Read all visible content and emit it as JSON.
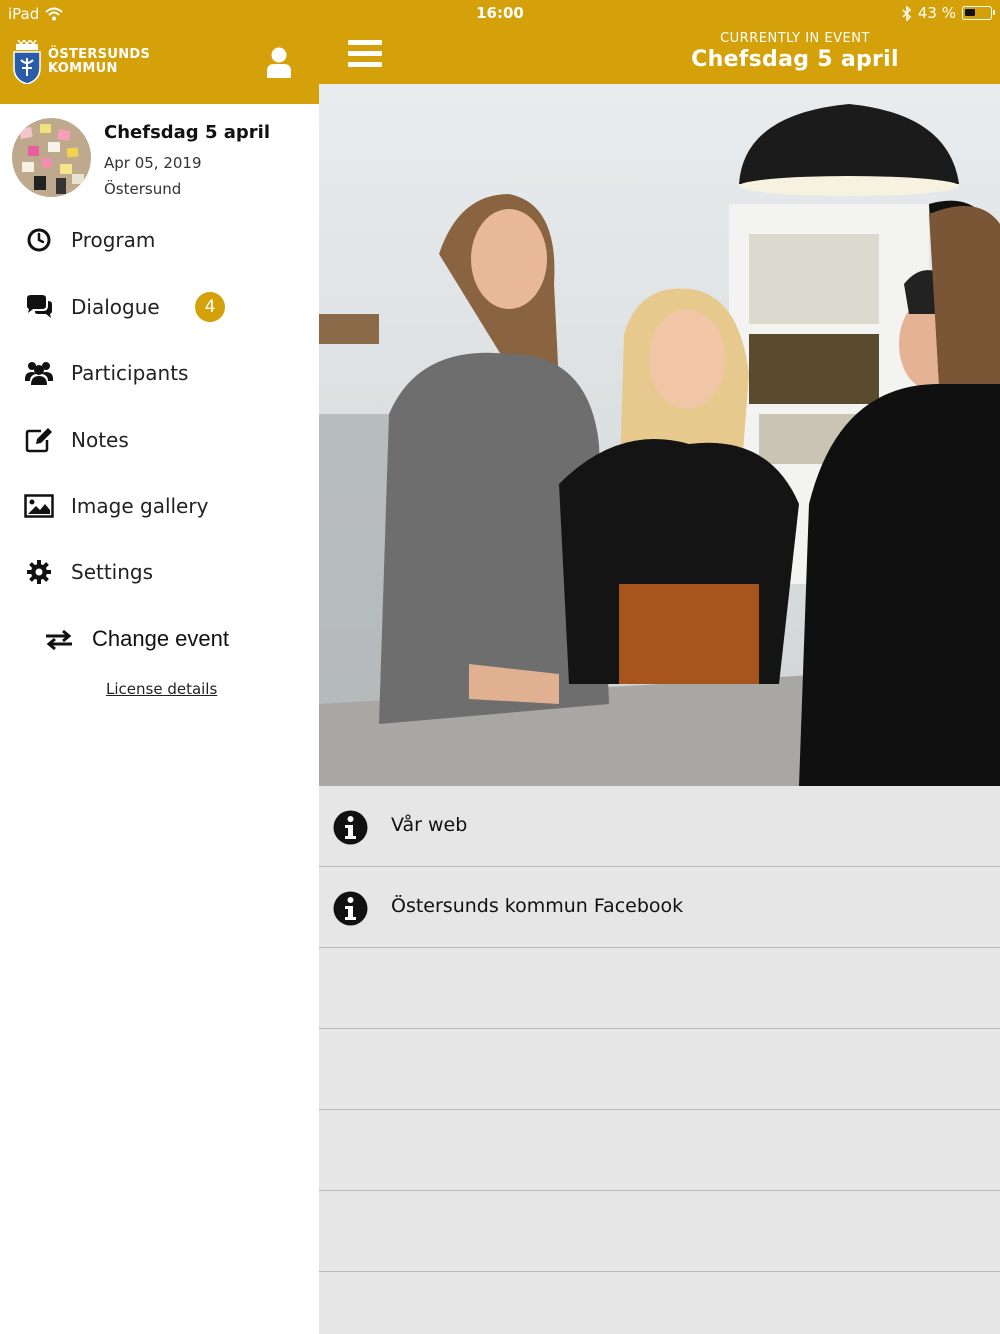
{
  "status_bar": {
    "device": "iPad",
    "time": "16:00",
    "battery_percent": "43 %",
    "battery_level": 0.43
  },
  "colors": {
    "brand": "#d4a10a",
    "background_list": "#e6e6e6"
  },
  "sidebar": {
    "logo_line1": "ÖSTERSUNDS",
    "logo_line2": "KOMMUN",
    "event": {
      "title": "Chefsdag 5 april",
      "date": "Apr 05, 2019",
      "location": "Östersund"
    },
    "items": [
      {
        "label": "Program",
        "icon": "clock-icon"
      },
      {
        "label": "Dialogue",
        "icon": "chat-bubbles-icon",
        "badge": "4"
      },
      {
        "label": "Participants",
        "icon": "users-icon"
      },
      {
        "label": "Notes",
        "icon": "edit-note-icon"
      },
      {
        "label": "Image gallery",
        "icon": "image-icon"
      },
      {
        "label": "Settings",
        "icon": "gear-icon"
      }
    ],
    "change_event_label": "Change event",
    "license_label": "License details"
  },
  "header": {
    "currently_label": "CURRENTLY IN EVENT",
    "event_name": "Chefsdag 5 april"
  },
  "links": [
    {
      "label": "Vår web",
      "icon": "info-icon"
    },
    {
      "label": "Östersunds kommun Facebook",
      "icon": "info-icon"
    }
  ]
}
